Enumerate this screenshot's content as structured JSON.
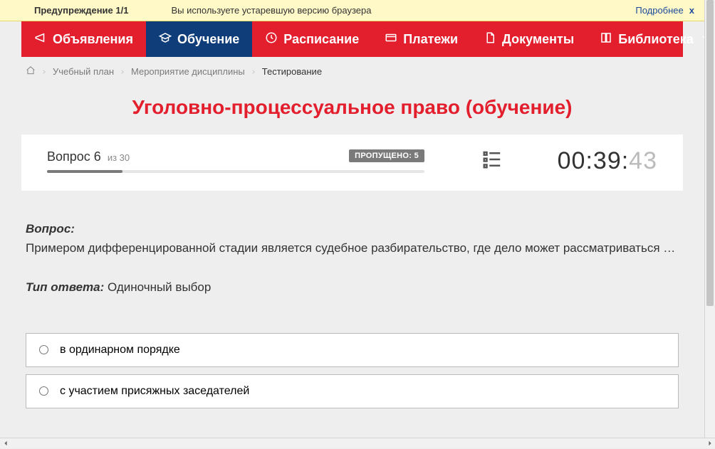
{
  "warning": {
    "title": "Предупреждение 1/1",
    "text": "Вы используете устаревшую версию браузера",
    "more": "Подробнее",
    "close": "x"
  },
  "nav": {
    "items": [
      {
        "label": "Объявления"
      },
      {
        "label": "Обучение"
      },
      {
        "label": "Расписание"
      },
      {
        "label": "Платежи"
      },
      {
        "label": "Документы"
      },
      {
        "label": "Библиотека"
      }
    ]
  },
  "breadcrumb": {
    "items": [
      "Учебный план",
      "Мероприятие дисциплины",
      "Тестирование"
    ]
  },
  "page_title": "Уголовно-процессуальное право (обучение)",
  "question": {
    "label": "Вопрос 6",
    "of": "из 30",
    "skipped_label": "ПРОПУЩЕНО: 5",
    "progress_percent": 20,
    "timer_main": "00:39:",
    "timer_ms": "43"
  },
  "body": {
    "question_label": "Вопрос:",
    "question_text": "Примером дифференцированной стадии является судебное разбирательство, где дело может рассматриваться …",
    "answer_type_label": "Тип ответа:",
    "answer_type_value": " Одиночный выбор"
  },
  "answers": [
    {
      "text": "в ординарном порядке"
    },
    {
      "text": "с участием присяжных заседателей"
    }
  ]
}
